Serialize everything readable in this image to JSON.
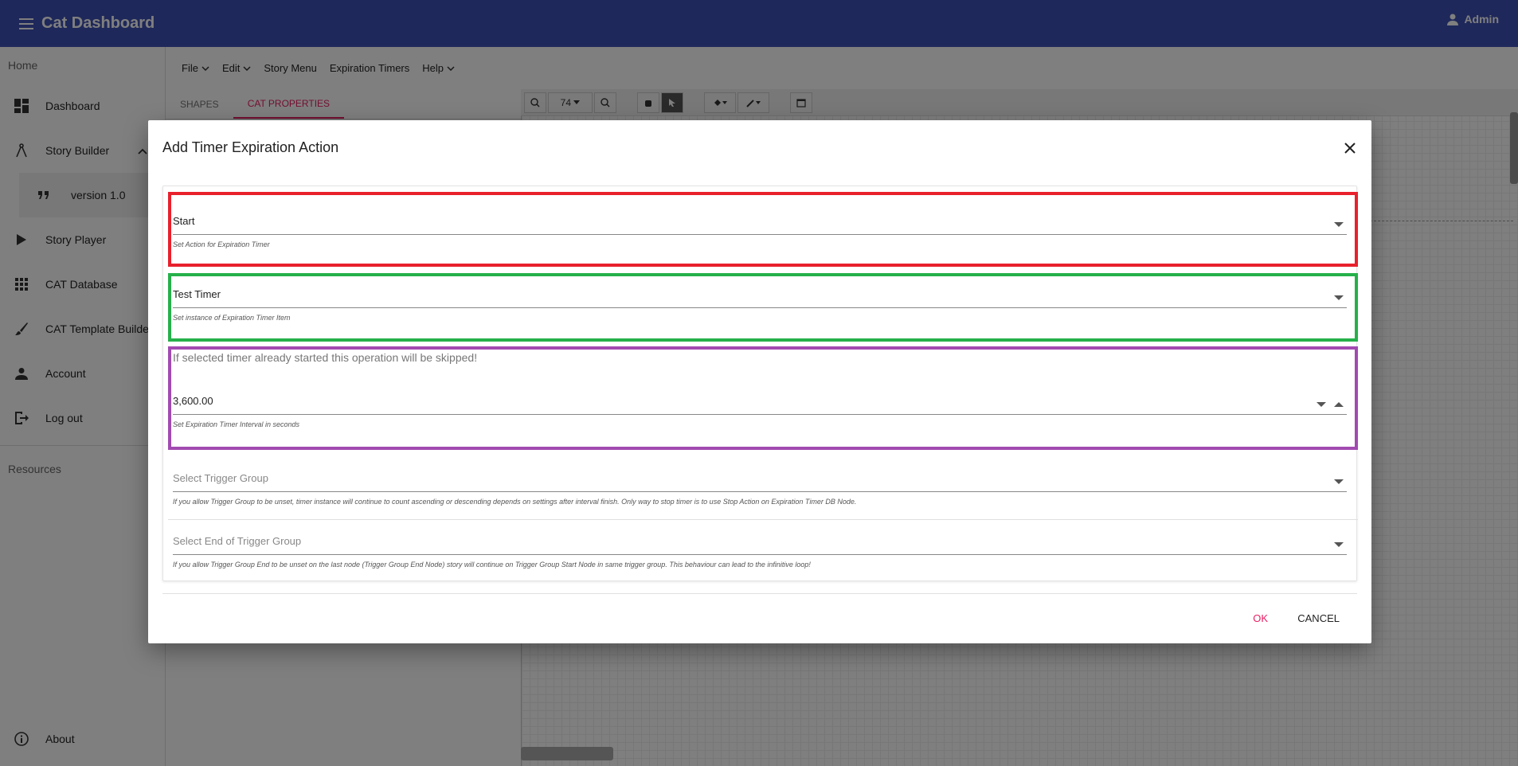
{
  "app": {
    "title": "Cat Dashboard",
    "user": "Admin"
  },
  "sidebar": {
    "home_label": "Home",
    "items": [
      {
        "label": "Dashboard",
        "icon": "dashboard-icon"
      },
      {
        "label": "Story Builder",
        "icon": "compass-icon"
      },
      {
        "label": "Story Player",
        "icon": "play-icon"
      },
      {
        "label": "CAT Database",
        "icon": "apps-icon"
      },
      {
        "label": "CAT Template Builder",
        "icon": "brush-icon"
      },
      {
        "label": "Account",
        "icon": "person-icon"
      },
      {
        "label": "Log out",
        "icon": "logout-icon"
      }
    ],
    "sub_item": "version 1.0",
    "resources_label": "Resources",
    "about": "About"
  },
  "menubar": {
    "items": [
      "File",
      "Edit",
      "Story Menu",
      "Expiration Timers",
      "Help"
    ]
  },
  "panel_tabs": {
    "shapes": "SHAPES",
    "cat_properties": "CAT PROPERTIES"
  },
  "toolbar": {
    "zoom": "74"
  },
  "dialog": {
    "title": "Add Timer Expiration Action",
    "action": {
      "value": "Start",
      "hint": "Set Action for Expiration Timer"
    },
    "timer": {
      "value": "Test Timer",
      "hint": "Set instance of Expiration Timer Item"
    },
    "warning": "If selected timer already started this operation will be skipped!",
    "interval": {
      "value": "3,600.00",
      "hint": "Set Expiration Timer Interval in seconds"
    },
    "trigger_group": {
      "placeholder": "Select Trigger Group",
      "hint": "If you allow Trigger Group to be unset, timer instance will continue to count ascending or descending depends on settings after interval finish. Only way to stop timer is to use Stop Action on Expiration Timer DB Node."
    },
    "trigger_group_end": {
      "placeholder": "Select End of Trigger Group",
      "hint": "If you allow Trigger Group End to be unset on the last node (Trigger Group End Node) story will continue on Trigger Group Start Node in same trigger group. This behaviour can lead to the infinitive loop!"
    },
    "ok": "OK",
    "cancel": "CANCEL"
  },
  "colors": {
    "appbar": "#3f51b5",
    "accent": "#e91e63",
    "highlight_red": "#e8202c",
    "highlight_green": "#25b04a",
    "highlight_purple": "#a24ab1"
  }
}
